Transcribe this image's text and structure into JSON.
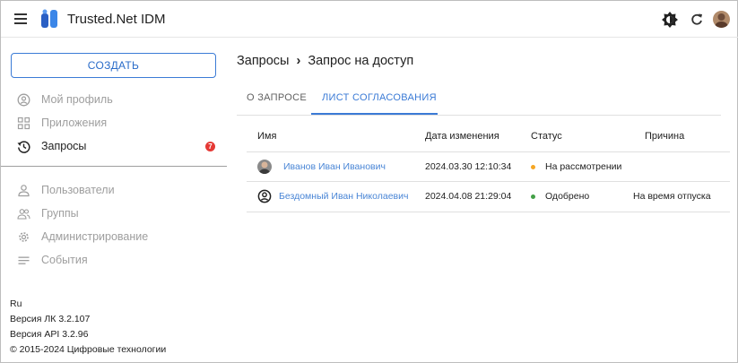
{
  "header": {
    "app_title": "Trusted.Net IDM"
  },
  "sidebar": {
    "create_label": "СОЗДАТЬ",
    "items": [
      {
        "label": "Мой профиль",
        "icon": "profile-icon"
      },
      {
        "label": "Приложения",
        "icon": "apps-icon"
      },
      {
        "label": "Запросы",
        "icon": "history-icon",
        "badge": "7"
      },
      {
        "label": "Пользователи",
        "icon": "user-icon"
      },
      {
        "label": "Группы",
        "icon": "group-icon"
      },
      {
        "label": "Администрирование",
        "icon": "gear-icon"
      },
      {
        "label": "События",
        "icon": "list-icon"
      }
    ],
    "footer": {
      "lang": "Ru",
      "version_lk": "Версия ЛК 3.2.107",
      "version_api": "Версия API 3.2.96",
      "copyright": "© 2015-2024 Цифровые технологии"
    }
  },
  "breadcrumb": {
    "parent": "Запросы",
    "current": "Запрос на доступ"
  },
  "tabs": [
    {
      "label": "О ЗАПРОСЕ",
      "active": false
    },
    {
      "label": "ЛИСТ СОГЛАСОВАНИЯ",
      "active": true
    }
  ],
  "table": {
    "columns": [
      "Имя",
      "Дата изменения",
      "Статус",
      "Причина"
    ],
    "rows": [
      {
        "name": "Иванов Иван Иванович",
        "date": "2024.03.30 12:10:34",
        "status": "На рассмотрении",
        "status_color": "#f5a623",
        "reason": ""
      },
      {
        "name": "Бездомный Иван Николаевич",
        "date": "2024.04.08 21:29:04",
        "status": "Одобрено",
        "status_color": "#43a047",
        "reason": "На время отпуска"
      }
    ]
  },
  "colors": {
    "accent": "#3b7bd6",
    "badge": "#e53935"
  }
}
